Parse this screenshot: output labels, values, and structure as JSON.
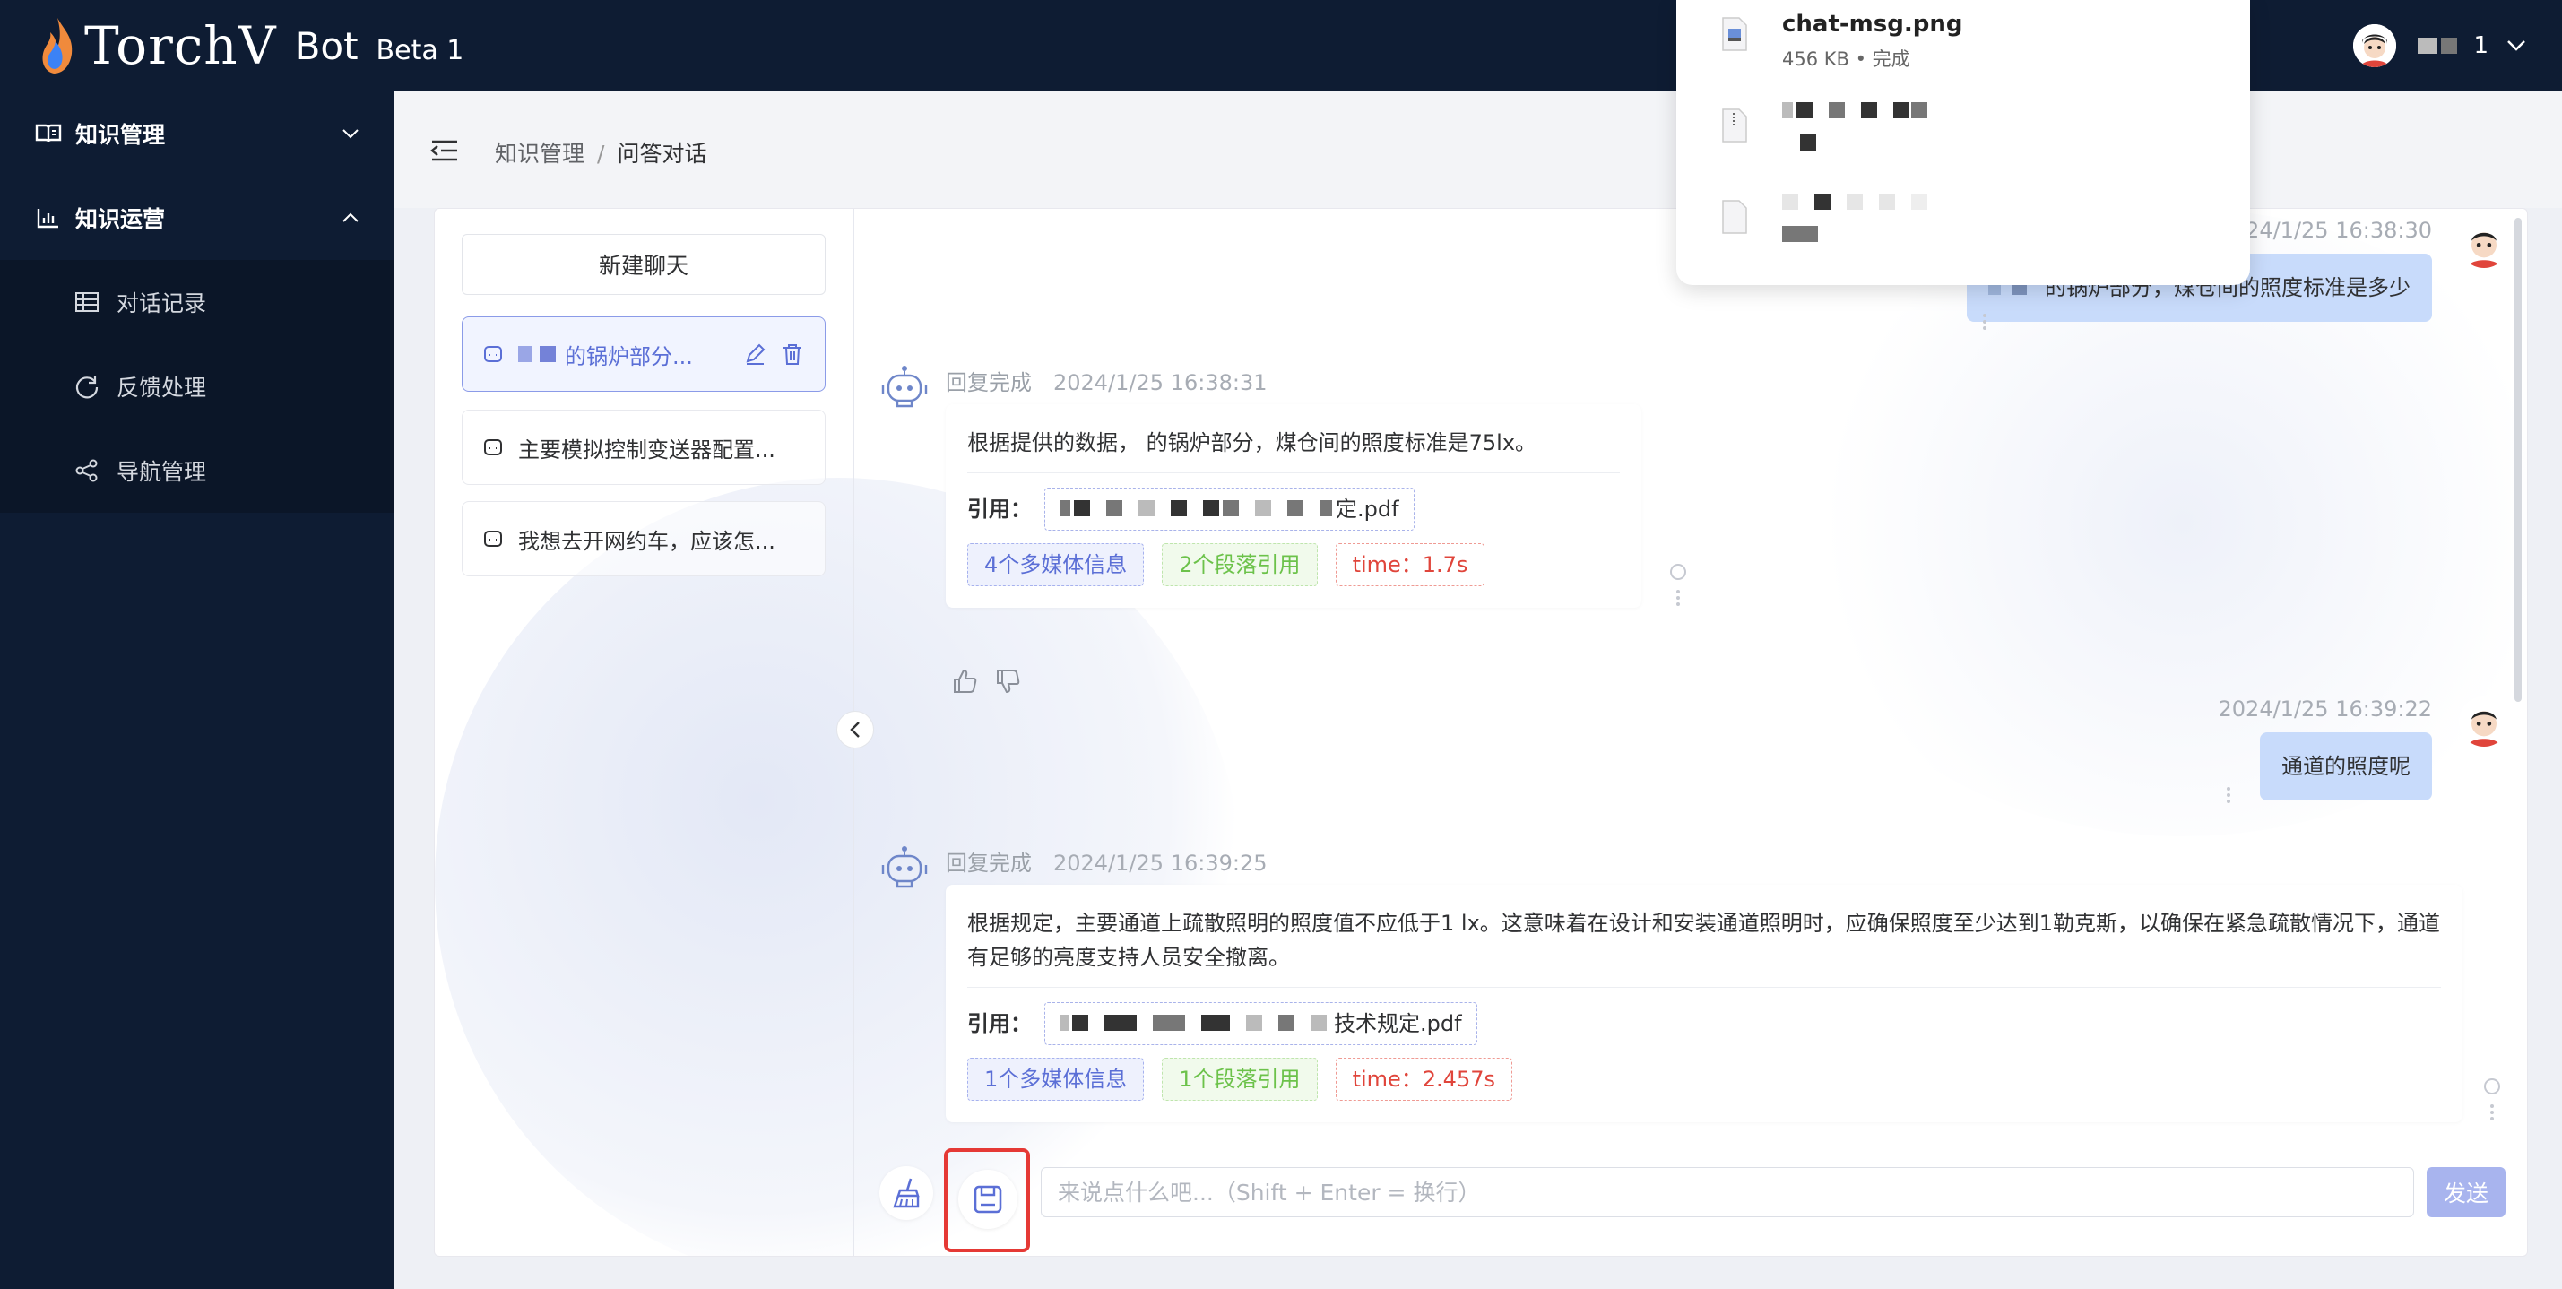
{
  "app": {
    "brand": "TorchV",
    "product": "Bot",
    "version": "Beta 1",
    "user_name": "1"
  },
  "sidebar": {
    "groups": [
      {
        "label": "知识管理",
        "icon": "book-icon",
        "expanded": false
      },
      {
        "label": "知识运营",
        "icon": "chart-icon",
        "expanded": true
      }
    ],
    "items": [
      {
        "label": "对话记录",
        "icon": "table-icon"
      },
      {
        "label": "反馈处理",
        "icon": "refresh-icon"
      },
      {
        "label": "导航管理",
        "icon": "share-icon"
      }
    ]
  },
  "breadcrumb": {
    "root": "知识管理",
    "separator": "/",
    "current": "问答对话"
  },
  "chatlist": {
    "new_chat_label": "新建聊天",
    "conversations": [
      {
        "title": "的锅炉部分...",
        "active": true
      },
      {
        "title": "主要模拟控制变送器配置...",
        "active": false
      },
      {
        "title": "我想去开网约车，应该怎...",
        "active": false
      }
    ]
  },
  "messages": [
    {
      "role": "user",
      "timestamp": "2024/1/25 16:38:30",
      "text": "的锅炉部分，煤仓间的照度标准是多少"
    },
    {
      "role": "bot",
      "status": "回复完成",
      "timestamp": "2024/1/25 16:38:31",
      "text": "根据提供的数据，       的锅炉部分，煤仓间的照度标准是75lx。",
      "cite_label": "引用：",
      "cite_file": "定.pdf",
      "tags": [
        "4个多媒体信息",
        "2个段落引用",
        "time：1.7s"
      ]
    },
    {
      "role": "user",
      "timestamp": "2024/1/25 16:39:22",
      "text": "通道的照度呢"
    },
    {
      "role": "bot",
      "status": "回复完成",
      "timestamp": "2024/1/25 16:39:25",
      "text": "根据规定，主要通道上疏散照明的照度值不应低于1 lx。这意味着在设计和安装通道照明时，应确保照度至少达到1勒克斯，以确保在紧急疏散情况下，通道有足够的亮度支持人员安全撤离。",
      "cite_label": "引用：",
      "cite_file": "技术规定.pdf",
      "tags": [
        "1个多媒体信息",
        "1个段落引用",
        "time：2.457s"
      ]
    }
  ],
  "composer": {
    "placeholder": "来说点什么吧...（Shift + Enter = 换行）",
    "value": "",
    "send_label": "发送"
  },
  "downloads": {
    "items": [
      {
        "name": "chat-msg.png",
        "detail": "456 KB • 完成"
      }
    ]
  },
  "colors": {
    "nav_bg": "#0e1c33",
    "accent": "#5b6fd6",
    "user_bubble": "#c8dbfb",
    "highlight": "#e53935"
  }
}
